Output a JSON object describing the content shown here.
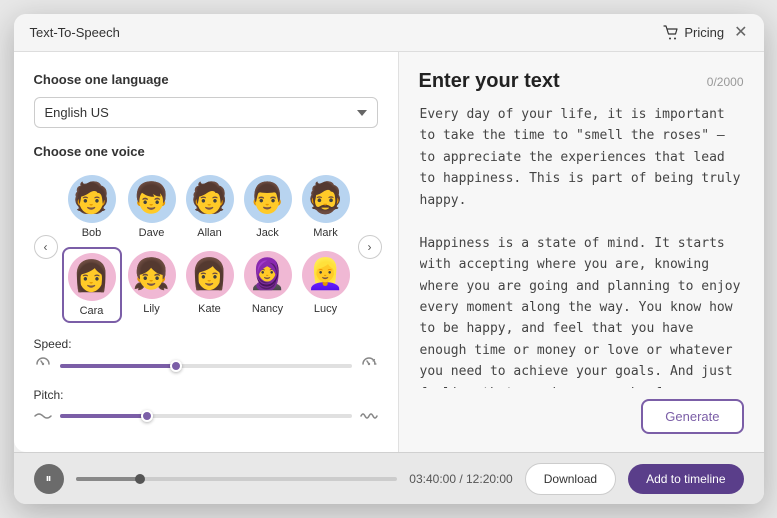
{
  "app": {
    "title": "Text-To-Speech",
    "pricing_label": "Pricing",
    "close_label": "✕"
  },
  "left_panel": {
    "language_section_title": "Choose one language",
    "language_value": "English US",
    "voice_section_title": "Choose one voice",
    "voices_row1": [
      {
        "name": "Bob",
        "gender": "male",
        "selected": false
      },
      {
        "name": "Dave",
        "gender": "male",
        "selected": false
      },
      {
        "name": "Allan",
        "gender": "male",
        "selected": false
      },
      {
        "name": "Jack",
        "gender": "male",
        "selected": false
      },
      {
        "name": "Mark",
        "gender": "male",
        "selected": false
      }
    ],
    "voices_row2": [
      {
        "name": "Cara",
        "gender": "female",
        "selected": true
      },
      {
        "name": "Lily",
        "gender": "female",
        "selected": false
      },
      {
        "name": "Kate",
        "gender": "female",
        "selected": false
      },
      {
        "name": "Nancy",
        "gender": "female",
        "selected": false
      },
      {
        "name": "Lucy",
        "gender": "female",
        "selected": false
      }
    ],
    "speed_label": "Speed:",
    "speed_value": 40,
    "pitch_label": "Pitch:",
    "pitch_value": 30
  },
  "right_panel": {
    "title": "Enter your text",
    "char_count": "0/2000",
    "text_content": "Every day of your life, it is important to take the time to \"smell the roses\" — to appreciate the experiences that lead to happiness. This is part of being truly happy.\n\nHappiness is a state of mind. It starts with accepting where you are, knowing where you are going and planning to enjoy every moment along the way. You know how to be happy, and feel that you have enough time or money or love or whatever you need to achieve your goals. And just feeling that you have enough of everything means that you do indeed have enough",
    "generate_label": "Generate"
  },
  "bottom_bar": {
    "time_display": "03:40:00 / 12:20:00",
    "download_label": "Download",
    "add_timeline_label": "Add to timeline"
  }
}
